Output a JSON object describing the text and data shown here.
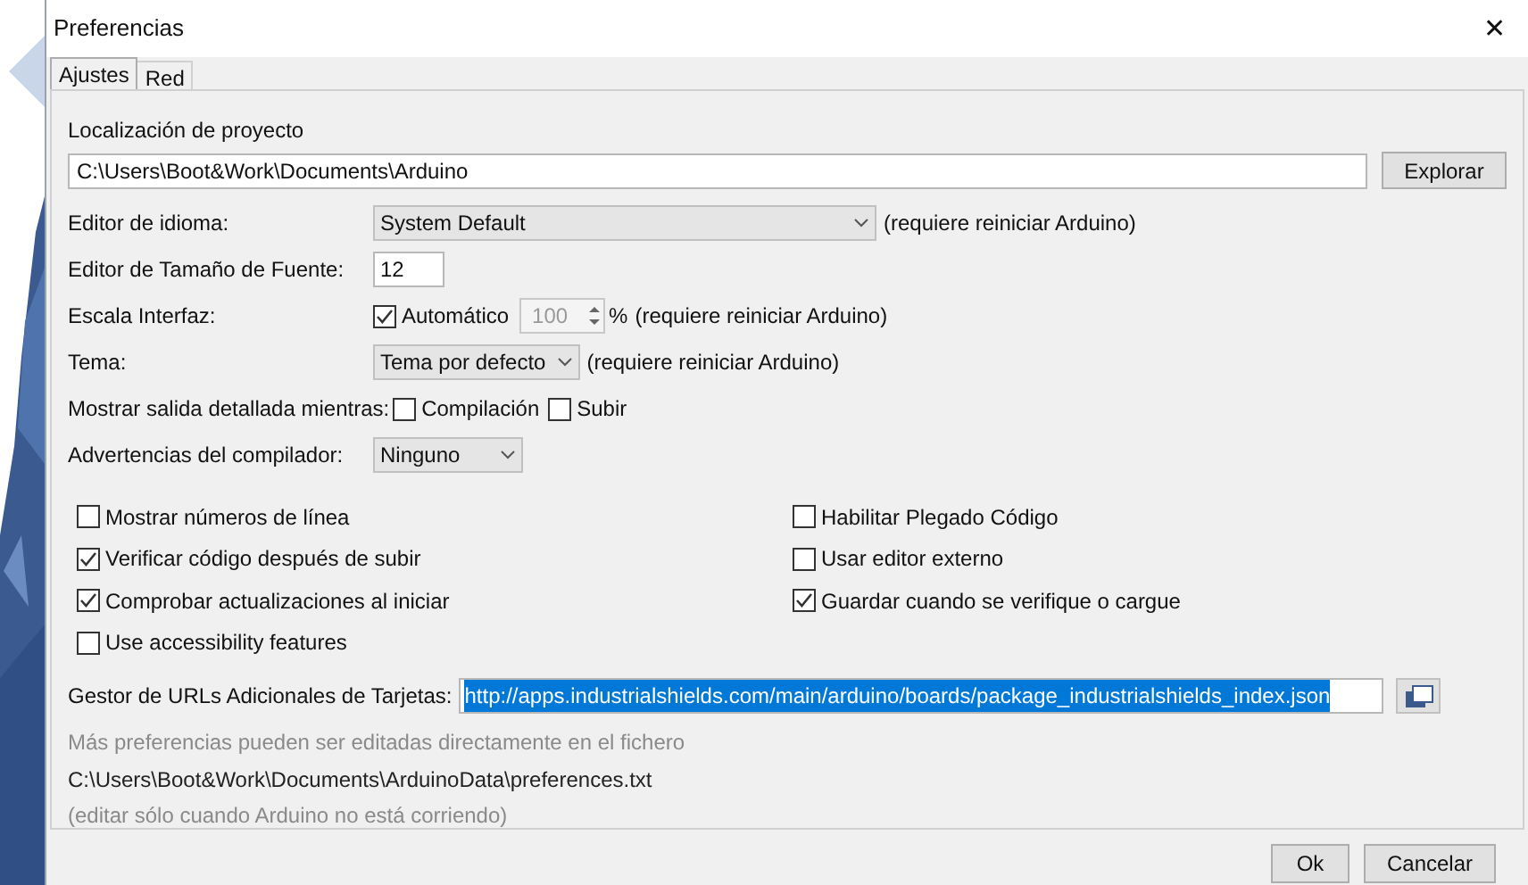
{
  "window": {
    "title": "Preferencias",
    "close": "✕"
  },
  "tabs": [
    {
      "label": "Ajustes",
      "selected": true
    },
    {
      "label": "Red",
      "selected": false
    }
  ],
  "project_location": {
    "label": "Localización de proyecto",
    "value": "C:\\Users\\Boot&Work\\Documents\\Arduino",
    "button": "Explorar"
  },
  "settings": [
    {
      "kind": "select",
      "label": "Editor de idioma:",
      "value": "System Default",
      "note": "(requiere reiniciar Arduino)"
    },
    {
      "kind": "number",
      "label": "Editor de Tamaño de Fuente:",
      "value": "12"
    },
    {
      "kind": "scale",
      "label": "Escala Interfaz:",
      "check_label": "Automático",
      "checked": true,
      "value": "100",
      "unit": "%",
      "note": "(requiere reiniciar Arduino)"
    },
    {
      "kind": "select",
      "label": "Tema:",
      "value": "Tema por defecto",
      "note": "(requiere reiniciar Arduino)"
    },
    {
      "kind": "checks",
      "label": "Mostrar salida detallada mientras:",
      "checks": [
        {
          "label": "Compilación",
          "checked": false
        },
        {
          "label": "Subir",
          "checked": false
        }
      ]
    },
    {
      "kind": "select",
      "label": "Advertencias del compilador:",
      "value": "Ninguno"
    }
  ],
  "options_left": [
    {
      "label": "Mostrar números de línea",
      "checked": false
    },
    {
      "label": "Verificar código después de subir",
      "checked": true
    },
    {
      "label": "Comprobar actualizaciones al iniciar",
      "checked": true
    },
    {
      "label": "Use accessibility features",
      "checked": false
    }
  ],
  "options_right": [
    {
      "label": "Habilitar Plegado Código",
      "checked": false
    },
    {
      "label": "Usar editor externo",
      "checked": false
    },
    {
      "label": "Guardar cuando se verifique o cargue",
      "checked": true
    }
  ],
  "board_urls": {
    "label": "Gestor de URLs Adicionales de Tarjetas:",
    "value": "http://apps.industrialshields.com/main/arduino/boards/package_industrialshields_index.json",
    "text_selected": true
  },
  "info": [
    {
      "text": "Más preferencias pueden ser editadas directamente en el fichero",
      "dimmed": true
    },
    {
      "text": "C:\\Users\\Boot&Work\\Documents\\ArduinoData\\preferences.txt",
      "dimmed": false
    },
    {
      "text": "(editar sólo cuando Arduino no está corriendo)",
      "dimmed": true
    }
  ],
  "buttons": [
    "Ok",
    "Cancelar"
  ]
}
